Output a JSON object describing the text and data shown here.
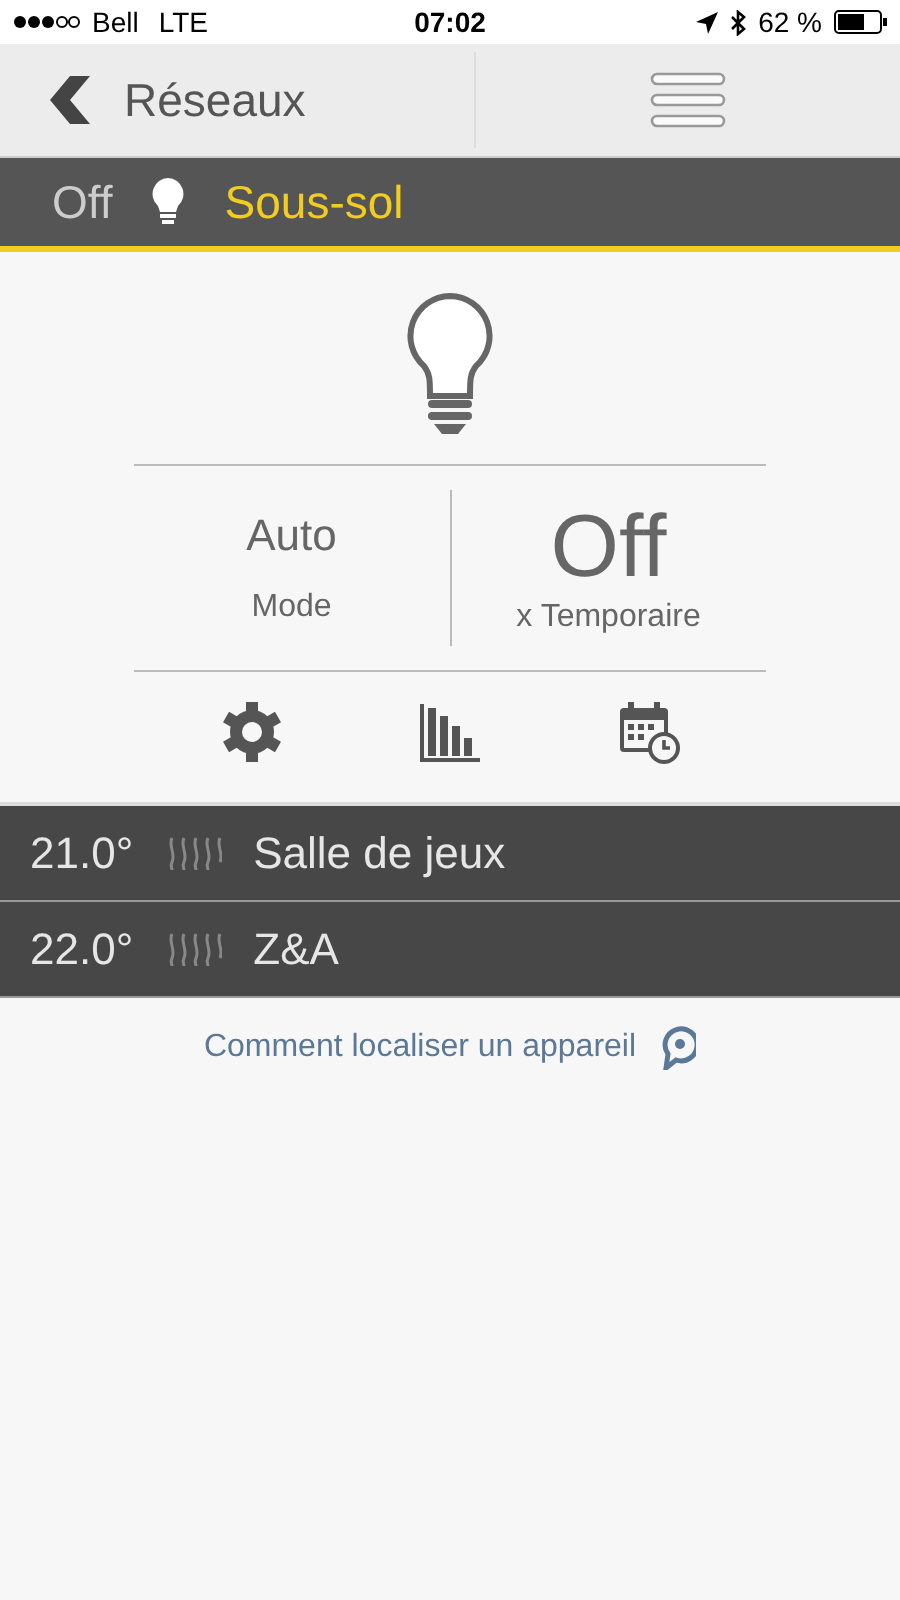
{
  "status_bar": {
    "carrier": "Bell",
    "network": "LTE",
    "time": "07:02",
    "battery": "62 %"
  },
  "nav": {
    "back_label": "Réseaux"
  },
  "device": {
    "state": "Off",
    "name": "Sous-sol"
  },
  "panel": {
    "mode_value": "Auto",
    "mode_label": "Mode",
    "override_value": "Off",
    "override_label": "x Temporaire"
  },
  "zones": [
    {
      "temperature": "21.0°",
      "name": "Salle de jeux"
    },
    {
      "temperature": "22.0°",
      "name": "Z&A"
    }
  ],
  "help_link": "Comment localiser un appareil"
}
